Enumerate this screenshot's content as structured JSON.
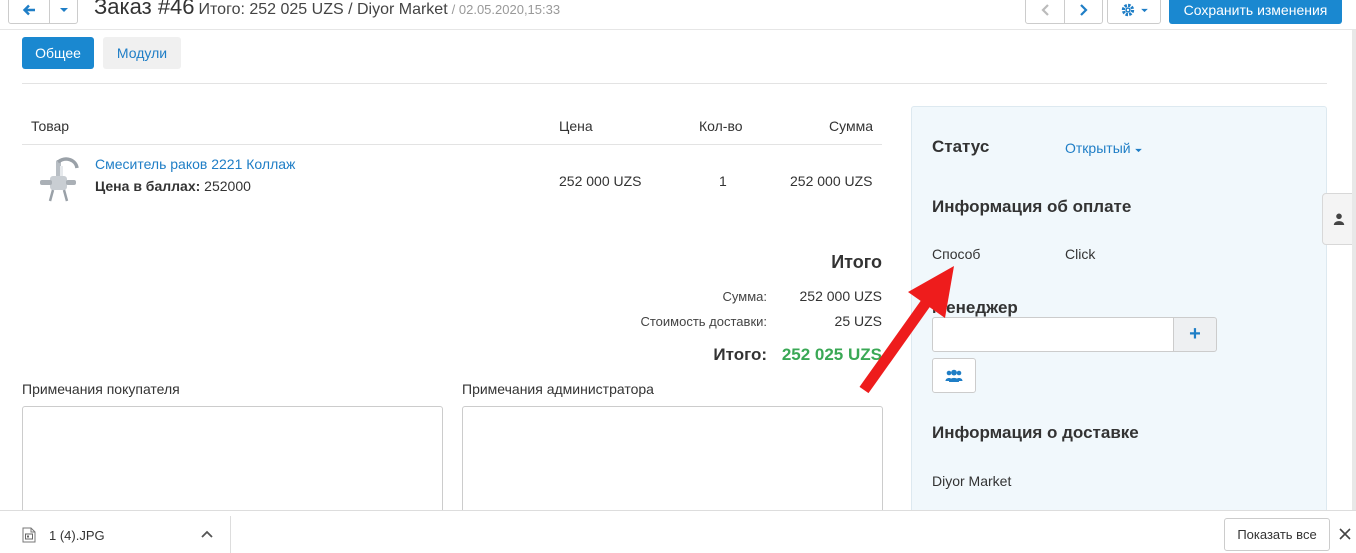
{
  "header": {
    "title": "Заказ #46",
    "subtitle": "Итого: 252 025 UZS / Diyor Market",
    "date": "/ 02.05.2020,15:33",
    "save_label": "Сохранить изменения"
  },
  "tabs": [
    {
      "label": "Общее",
      "active": true
    },
    {
      "label": "Модули",
      "active": false
    }
  ],
  "table": {
    "columns": [
      "Товар",
      "Цена",
      "Кол-во",
      "Сумма"
    ],
    "rows": [
      {
        "name": "Смеситель раков 2221 Коллаж",
        "points_label": "Цена в баллах:",
        "points_value": " 252000",
        "price": "252 000 UZS",
        "qty": "1",
        "sum": "252 000 UZS"
      }
    ]
  },
  "totals": {
    "heading": "Итого",
    "sum_label": "Сумма:",
    "sum_value": "252 000 UZS",
    "delivery_label": "Стоимость доставки:",
    "delivery_value": "25 UZS",
    "grand_label": "Итого:",
    "grand_value": "252 025 UZS"
  },
  "notes": {
    "customer_label": "Примечания покупателя",
    "admin_label": "Примечания администратора"
  },
  "panel": {
    "status_label": "Статус",
    "status_value": "Открытый",
    "payment_heading": "Информация об оплате",
    "method_label": "Способ",
    "method_value": "Click",
    "manager_heading": "Менеджер",
    "manager_add": "+",
    "delivery_heading": "Информация о доставке",
    "delivery_value": "Diyor Market"
  },
  "download_bar": {
    "file_name": "1 (4).JPG",
    "show_all_label": "Показать все"
  },
  "colors": {
    "accent": "#1a88d0",
    "link": "#1f7ec6",
    "total_green": "#3aa855",
    "panel_bg": "#f1f8fc",
    "arrow_red": "#ee1c1c"
  }
}
